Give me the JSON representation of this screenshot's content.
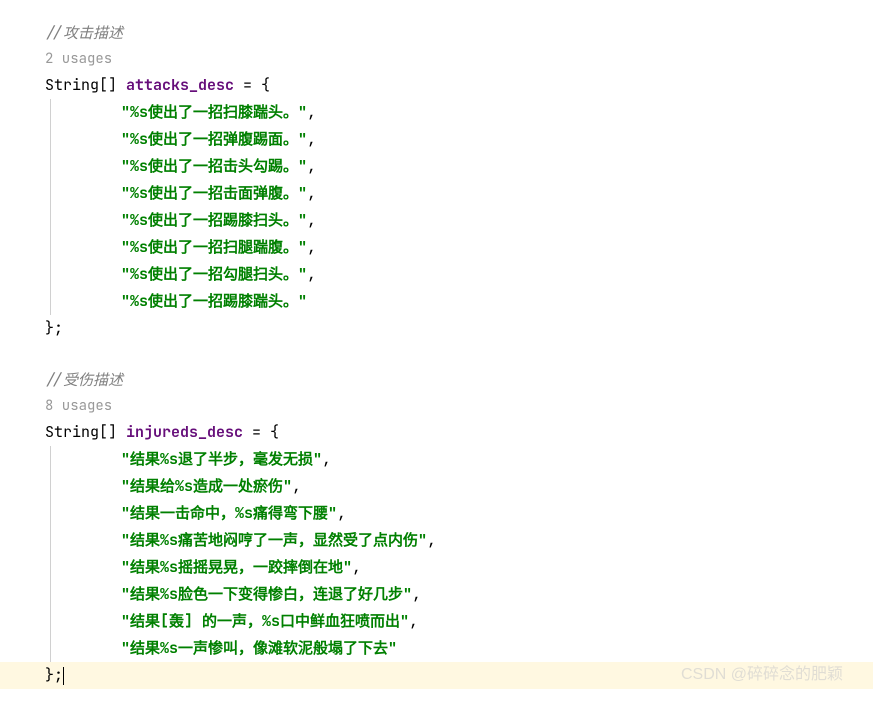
{
  "block1": {
    "comment_prefix": "//",
    "comment_text": "攻击描述",
    "usages": "2 usages",
    "decl_type": "String[] ",
    "decl_name": "attacks_desc",
    "decl_suffix": " = {",
    "strings": [
      "\"%s使出了一招扫膝踹头。\"",
      "\"%s使出了一招弹腹踢面。\"",
      "\"%s使出了一招击头勾踢。\"",
      "\"%s使出了一招击面弹腹。\"",
      "\"%s使出了一招踢膝扫头。\"",
      "\"%s使出了一招扫腿踹腹。\"",
      "\"%s使出了一招勾腿扫头。\"",
      "\"%s使出了一招踢膝踹头。\""
    ],
    "close": "};"
  },
  "block2": {
    "comment_prefix": "//",
    "comment_text": "受伤描述",
    "usages": "8 usages",
    "decl_type": "String[] ",
    "decl_name": "injureds_desc",
    "decl_suffix": " = {",
    "strings": [
      "\"结果%s退了半步，毫发无损\"",
      "\"结果给%s造成一处瘀伤\"",
      "\"结果一击命中，%s痛得弯下腰\"",
      "\"结果%s痛苦地闷哼了一声，显然受了点内伤\"",
      "\"结果%s摇摇晃晃，一跤摔倒在地\"",
      "\"结果%s脸色一下变得惨白，连退了好几步\"",
      "\"结果[轰] 的一声，%s口中鲜血狂喷而出\"",
      "\"结果%s一声惨叫，像滩软泥般塌了下去\""
    ],
    "close": "};"
  },
  "watermark": "CSDN @碎碎念的肥颖",
  "comma": "，",
  "trailing_comma": ","
}
